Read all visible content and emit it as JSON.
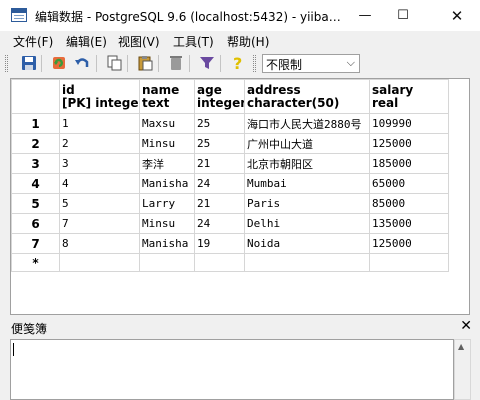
{
  "window": {
    "title": "编辑数据 - PostgreSQL 9.6 (localhost:5432) - yiiba…",
    "minimize_glyph": "—",
    "maximize_glyph": "☐",
    "close_glyph": "✕"
  },
  "menu": [
    {
      "label": "文件(F)"
    },
    {
      "label": "编辑(E)"
    },
    {
      "label": "视图(V)"
    },
    {
      "label": "工具(T)"
    },
    {
      "label": "帮助(H)"
    }
  ],
  "toolbar": {
    "icons": [
      "save-icon",
      "refresh-icon",
      "undo-icon",
      "copy-icon",
      "paste-icon",
      "delete-icon",
      "filter-icon",
      "help-icon"
    ],
    "limit_value": "不限制",
    "limit_arrow": "⌵"
  },
  "grid": {
    "columns": [
      {
        "name": "id",
        "type": "[PK] integer"
      },
      {
        "name": "name",
        "type": "text"
      },
      {
        "name": "age",
        "type": "integer"
      },
      {
        "name": "address",
        "type": "character(50)"
      },
      {
        "name": "salary",
        "type": "real"
      }
    ],
    "rows": [
      {
        "num": "1",
        "cells": [
          "1",
          "Maxsu",
          "25",
          "海口市人民大道2880号",
          "109990"
        ]
      },
      {
        "num": "2",
        "cells": [
          "2",
          "Minsu",
          "25",
          "广州中山大道",
          "125000"
        ]
      },
      {
        "num": "3",
        "cells": [
          "3",
          "李洋",
          "21",
          "北京市朝阳区",
          "185000"
        ]
      },
      {
        "num": "4",
        "cells": [
          "4",
          "Manisha",
          "24",
          "Mumbai",
          "65000"
        ]
      },
      {
        "num": "5",
        "cells": [
          "5",
          "Larry",
          "21",
          "Paris",
          "85000"
        ]
      },
      {
        "num": "6",
        "cells": [
          "7",
          "Minsu",
          "24",
          "Delhi",
          "135000"
        ]
      },
      {
        "num": "7",
        "cells": [
          "8",
          "Manisha",
          "19",
          "Noida",
          "125000"
        ]
      }
    ],
    "new_row_marker": "*"
  },
  "notes": {
    "title": "便笺簿",
    "close_glyph": "✕",
    "scroll_up_glyph": "▲"
  },
  "colors": {
    "save": "#2d5ea8",
    "refresh": "#3a9a3a",
    "undo": "#2d5ea8",
    "delete": "#9a9a9a",
    "filter": "#6a4aa0",
    "help": "#e0c000"
  }
}
